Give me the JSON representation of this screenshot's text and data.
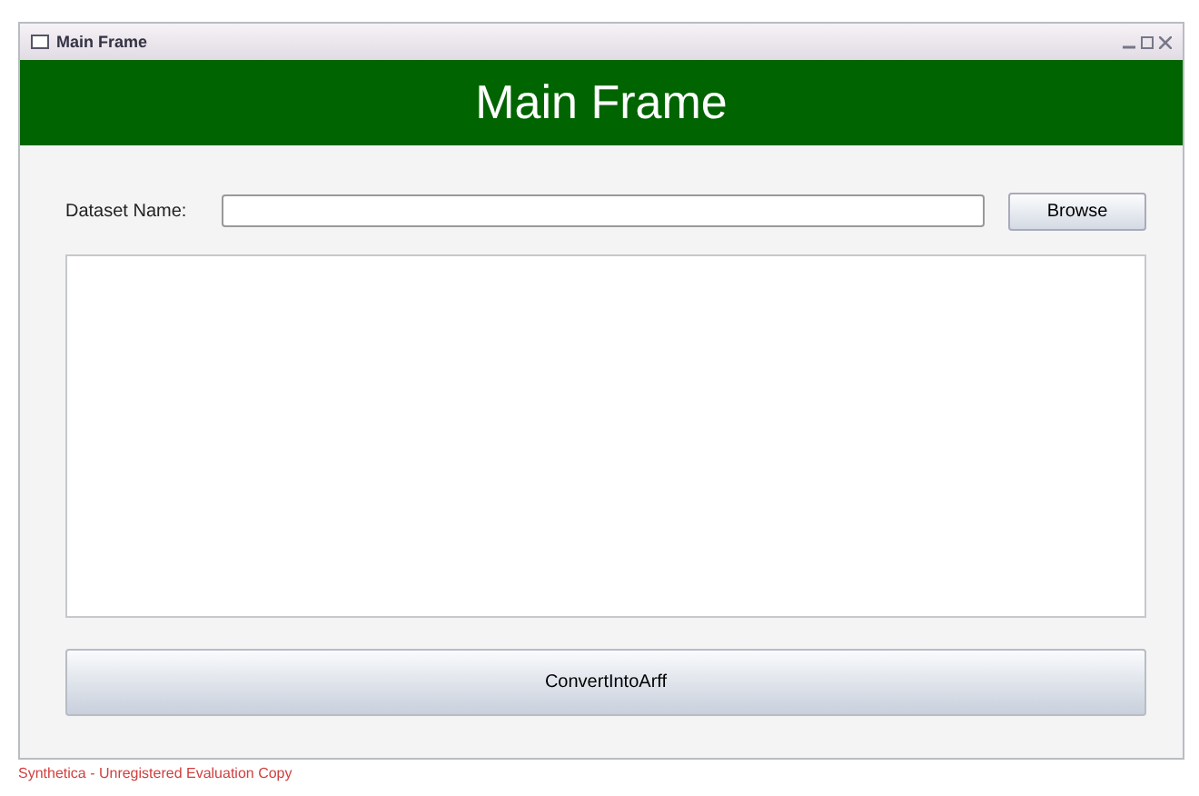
{
  "window": {
    "title": "Main Frame"
  },
  "header": {
    "title": "Main Frame"
  },
  "dataset": {
    "label": "Dataset Name:"
  },
  "buttons": {
    "browse": "Browse",
    "convert": "ConvertIntoArff"
  },
  "status_bar": {
    "text": "Synthetica - Unregistered Evaluation Copy"
  }
}
